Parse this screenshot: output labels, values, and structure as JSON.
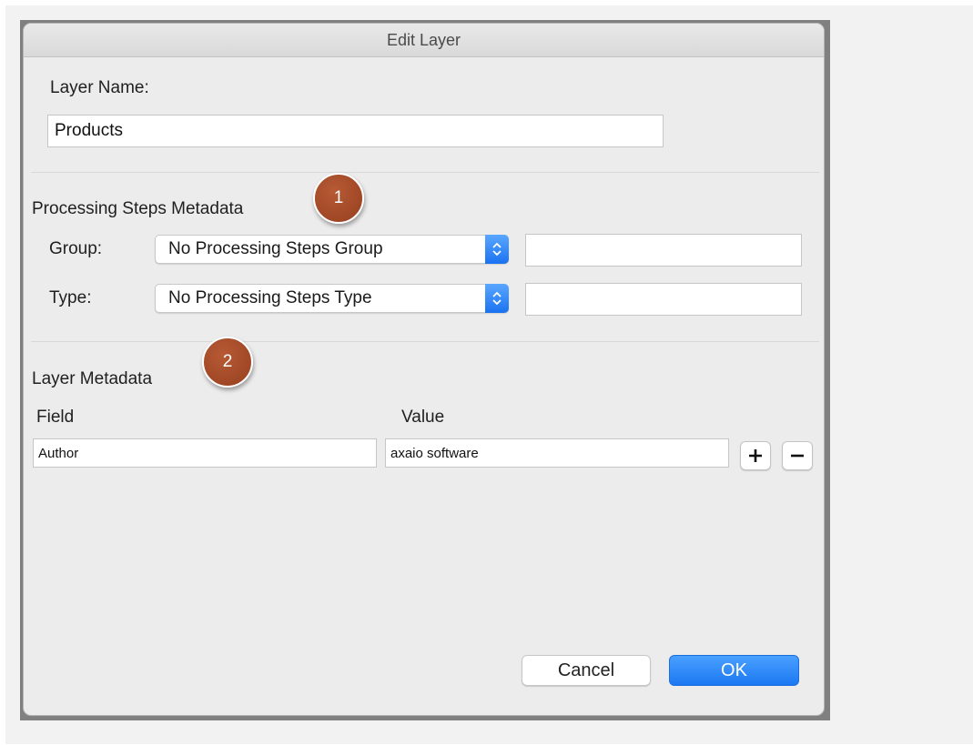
{
  "window": {
    "title": "Edit Layer"
  },
  "layer_name": {
    "label": "Layer Name:",
    "value": "Products"
  },
  "processing": {
    "heading": "Processing Steps Metadata",
    "badge": "1",
    "group_label": "Group:",
    "group_selected": "No Processing Steps Group",
    "group_text": "",
    "type_label": "Type:",
    "type_selected": "No Processing Steps Type",
    "type_text": ""
  },
  "layer_metadata": {
    "heading": "Layer Metadata",
    "badge": "2",
    "col_field": "Field",
    "col_value": "Value",
    "rows": [
      {
        "field": "Author",
        "value": "axaio software"
      }
    ]
  },
  "buttons": {
    "cancel": "Cancel",
    "ok": "OK"
  },
  "icons": {
    "stepper": "chevron-up-down-icon",
    "add": "plus-icon",
    "remove": "minus-icon"
  },
  "colors": {
    "accent": "#1b78f2",
    "badge": "#a2472a"
  }
}
